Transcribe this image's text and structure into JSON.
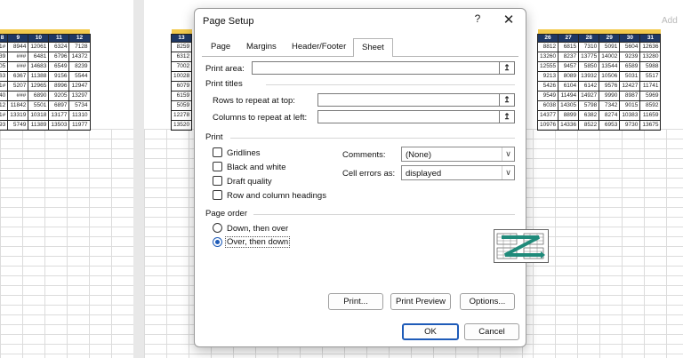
{
  "background": {
    "add_text": "Add",
    "left_page": {
      "headers": [
        "8",
        "9",
        "10",
        "11",
        "12"
      ],
      "rows": [
        [
          "1#",
          "8944",
          "12061",
          "6324",
          "7128"
        ],
        [
          "39",
          "###",
          "6481",
          "6796",
          "14372"
        ],
        [
          "05",
          "###",
          "14683",
          "6549",
          "8239"
        ],
        [
          "63",
          "6367",
          "11388",
          "9156",
          "5544"
        ],
        [
          "1#",
          "5207",
          "12965",
          "8996",
          "12947"
        ],
        [
          "40",
          "###",
          "6890",
          "9205",
          "13297"
        ],
        [
          "12",
          "11842",
          "5501",
          "6897",
          "5734"
        ],
        [
          "1#",
          "13319",
          "10318",
          "13177",
          "11310"
        ],
        [
          "93",
          "5749",
          "11389",
          "13503",
          "11977"
        ]
      ]
    },
    "mid_page": {
      "headers": [
        "13"
      ],
      "rows": [
        [
          "8259"
        ],
        [
          "6312"
        ],
        [
          "7002"
        ],
        [
          "10028"
        ],
        [
          "6079"
        ],
        [
          "6159"
        ],
        [
          "5059"
        ],
        [
          "12278"
        ],
        [
          "13520"
        ]
      ]
    },
    "right_page": {
      "headers": [
        "26",
        "27",
        "28",
        "29",
        "30",
        "31"
      ],
      "rows": [
        [
          "8812",
          "6815",
          "7310",
          "5091",
          "5604",
          "12636"
        ],
        [
          "13260",
          "8237",
          "13775",
          "14002",
          "9239",
          "13280"
        ],
        [
          "12555",
          "9457",
          "5850",
          "13544",
          "6589",
          "5988"
        ],
        [
          "9213",
          "8089",
          "13932",
          "10506",
          "5031",
          "5517"
        ],
        [
          "5426",
          "6104",
          "6142",
          "9576",
          "12427",
          "11741"
        ],
        [
          "9549",
          "11494",
          "14927",
          "9990",
          "8987",
          "5969"
        ],
        [
          "6038",
          "14305",
          "5798",
          "7342",
          "9015",
          "8592"
        ],
        [
          "14377",
          "8899",
          "6382",
          "8274",
          "10383",
          "11659"
        ],
        [
          "10976",
          "14336",
          "8522",
          "6953",
          "9730",
          "13675"
        ]
      ]
    }
  },
  "dialog": {
    "title": "Page Setup",
    "help": "?",
    "close": "✕",
    "tabs": [
      "Page",
      "Margins",
      "Header/Footer",
      "Sheet"
    ],
    "active_tab": "Sheet",
    "print_area_label": "Print area:",
    "print_titles_label": "Print titles",
    "rows_repeat_label": "Rows to repeat at top:",
    "cols_repeat_label": "Columns to repeat at left:",
    "print_section_label": "Print",
    "checkboxes": [
      "Gridlines",
      "Black and white",
      "Draft quality",
      "Row and column headings"
    ],
    "comments_label": "Comments:",
    "comments_value": "(None)",
    "cell_errors_label": "Cell errors as:",
    "cell_errors_value": "displayed",
    "page_order_label": "Page order",
    "order_options": [
      "Down, then over",
      "Over, then down"
    ],
    "selected_order": "Over, then down",
    "buttons": {
      "print": "Print...",
      "print_preview": "Print Preview",
      "options": "Options...",
      "ok": "OK",
      "cancel": "Cancel"
    },
    "collapse_icon": "↥",
    "dropdown_icon": "∨"
  }
}
